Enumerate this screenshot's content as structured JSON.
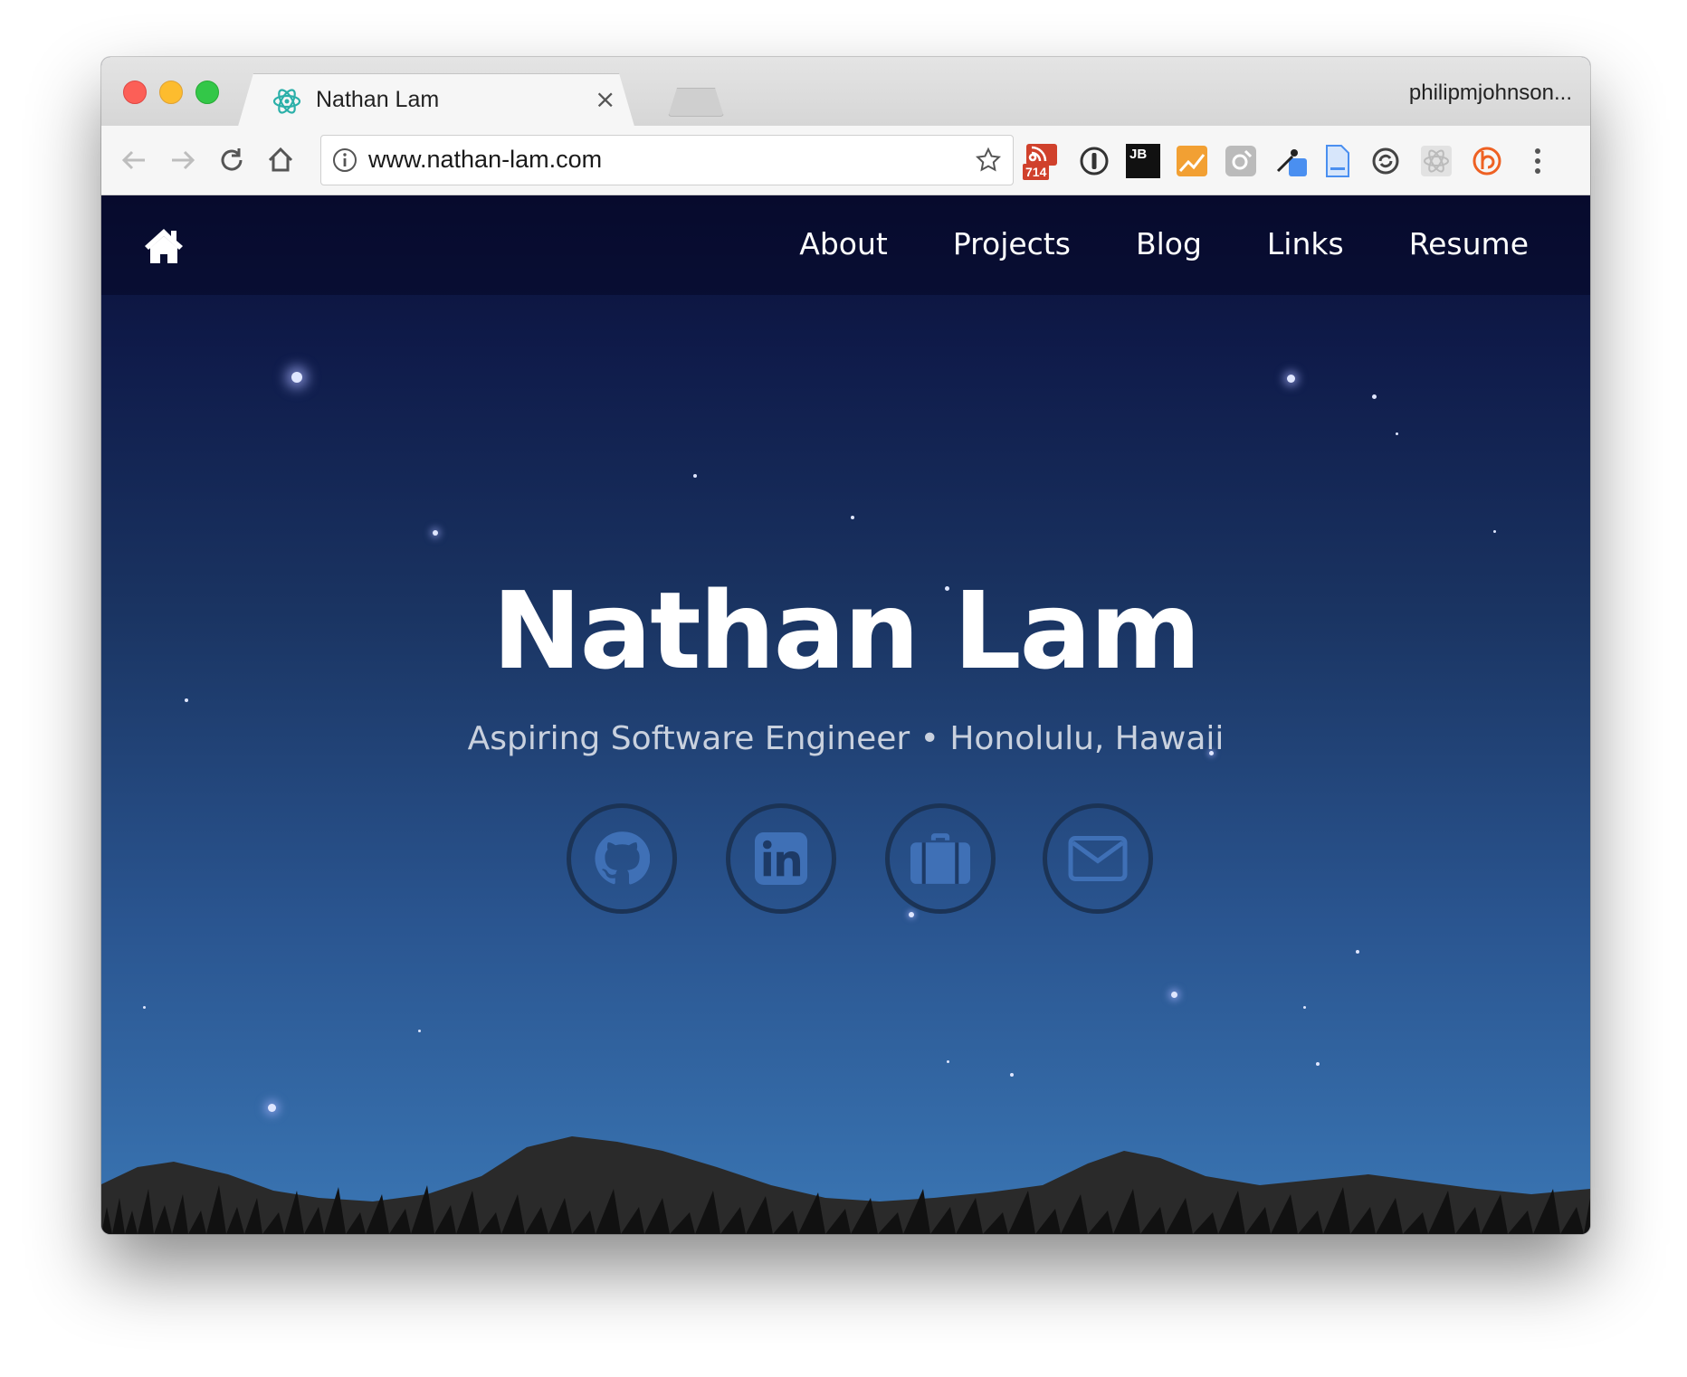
{
  "browser": {
    "tab_title": "Nathan Lam",
    "tab_close": "×",
    "profile_name": "philipmjohnson...",
    "url": "www.nathan-lam.com",
    "rss_badge": "714",
    "jb_label": "JB"
  },
  "site": {
    "nav": {
      "about": "About",
      "projects": "Projects",
      "blog": "Blog",
      "links": "Links",
      "resume": "Resume"
    },
    "hero": {
      "name": "Nathan Lam",
      "subtitle": "Aspiring Software Engineer •  Honolulu, Hawaii"
    },
    "social": [
      "github-icon",
      "linkedin-icon",
      "briefcase-icon",
      "envelope-icon"
    ]
  },
  "colors": {
    "icon_blue": "#3f70b6",
    "circle_border": "#1b3355"
  }
}
